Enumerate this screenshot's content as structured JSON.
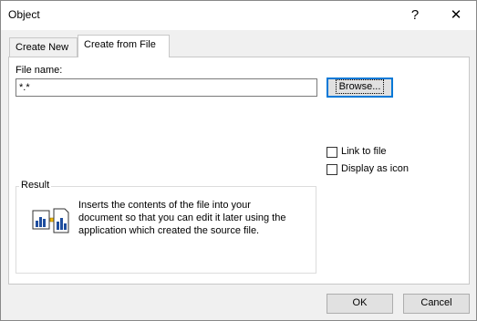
{
  "window": {
    "title": "Object",
    "help": "?",
    "close": "✕"
  },
  "tabs": [
    {
      "label": "Create New",
      "active": false
    },
    {
      "label": "Create from File",
      "active": true
    }
  ],
  "file_name": {
    "label": "File name:",
    "value": "*.*"
  },
  "browse_label": "Browse...",
  "options": [
    {
      "label": "Link to file",
      "checked": false
    },
    {
      "label": "Display as icon",
      "checked": false
    }
  ],
  "result": {
    "title": "Result",
    "text": "Inserts the contents of the file into your document so that you can edit it later using the application which created the source file.",
    "icon": "insert-file-icon"
  },
  "buttons": {
    "ok": "OK",
    "cancel": "Cancel"
  },
  "colors": {
    "focus_border": "#0078d7",
    "button_face": "#e1e1e1"
  }
}
